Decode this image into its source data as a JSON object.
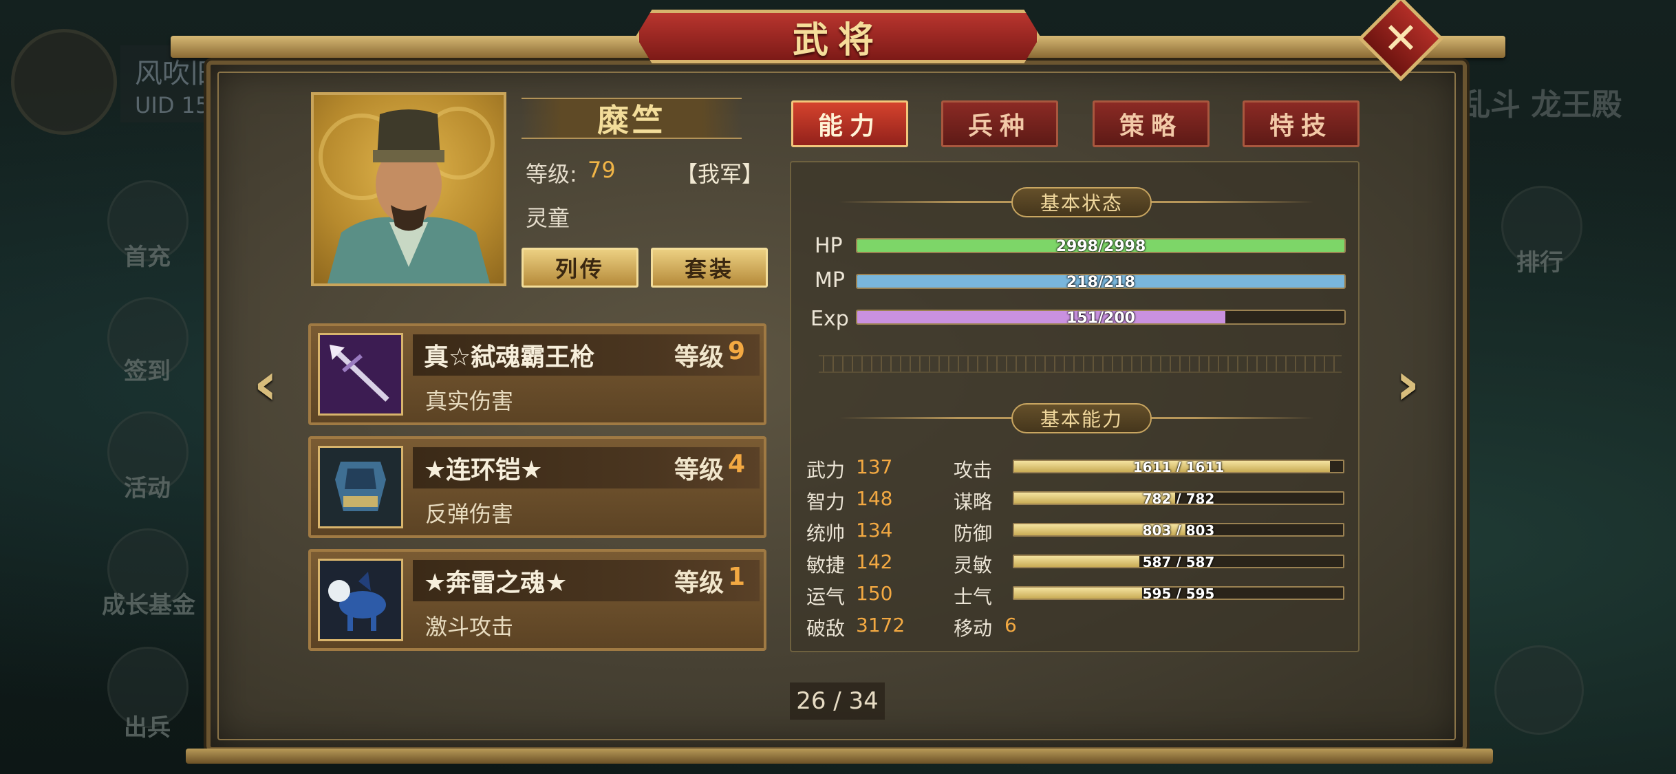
{
  "background": {
    "player_name": "风吹旧",
    "player_uid": "UID 15",
    "right_title": "乱斗 龙王殿",
    "left_menu": [
      "首充",
      "签到",
      "活动",
      "成长基金",
      "出兵"
    ],
    "right_menu": [
      "排行"
    ]
  },
  "window": {
    "title": "武将",
    "close_label": "✕",
    "prev_label": "‹",
    "next_label": "›"
  },
  "hero": {
    "name": "糜竺",
    "level_label": "等级:",
    "level": "79",
    "faction": "【我军】",
    "class": "灵童",
    "bio_button": "列传",
    "set_button": "套装"
  },
  "equipment": [
    {
      "name": "真☆弑魂霸王枪",
      "level_label": "等级",
      "level": "9",
      "effect": "真实伤害",
      "icon": "spear-icon"
    },
    {
      "name": "★连环铠★",
      "level_label": "等级",
      "level": "4",
      "effect": "反弹伤害",
      "icon": "armor-icon"
    },
    {
      "name": "★奔雷之魂★",
      "level_label": "等级",
      "level": "1",
      "effect": "激斗攻击",
      "icon": "mount-icon"
    }
  ],
  "tabs": [
    {
      "label": "能力",
      "active": true
    },
    {
      "label": "兵种",
      "active": false
    },
    {
      "label": "策略",
      "active": false
    },
    {
      "label": "特技",
      "active": false
    }
  ],
  "basic_status": {
    "title": "基本状态",
    "bars": [
      {
        "label": "HP",
        "text": "2998/2998",
        "ratio": 1.0,
        "color": "#7dd668"
      },
      {
        "label": "MP",
        "text": "218/218",
        "ratio": 1.0,
        "color": "#79b6dc"
      },
      {
        "label": "Exp",
        "text": "151/200",
        "ratio": 0.755,
        "color": "#c991e0"
      }
    ]
  },
  "basic_ability": {
    "title": "基本能力",
    "attributes": [
      {
        "label": "武力",
        "value": "137"
      },
      {
        "label": "智力",
        "value": "148"
      },
      {
        "label": "统帅",
        "value": "134"
      },
      {
        "label": "敏捷",
        "value": "142"
      },
      {
        "label": "运气",
        "value": "150"
      },
      {
        "label": "破敌",
        "value": "3172"
      }
    ],
    "combat": [
      {
        "label": "攻击",
        "text": "1611 / 1611",
        "ratio": 0.96
      },
      {
        "label": "谋略",
        "text": "782 / 782",
        "ratio": 0.49
      },
      {
        "label": "防御",
        "text": "803 / 803",
        "ratio": 0.52
      },
      {
        "label": "灵敏",
        "text": "587 / 587",
        "ratio": 0.38
      },
      {
        "label": "士气",
        "text": "595 / 595",
        "ratio": 0.39
      }
    ],
    "move_label": "移动",
    "move_value": "6"
  },
  "pagination": {
    "text": "26 / 34"
  }
}
